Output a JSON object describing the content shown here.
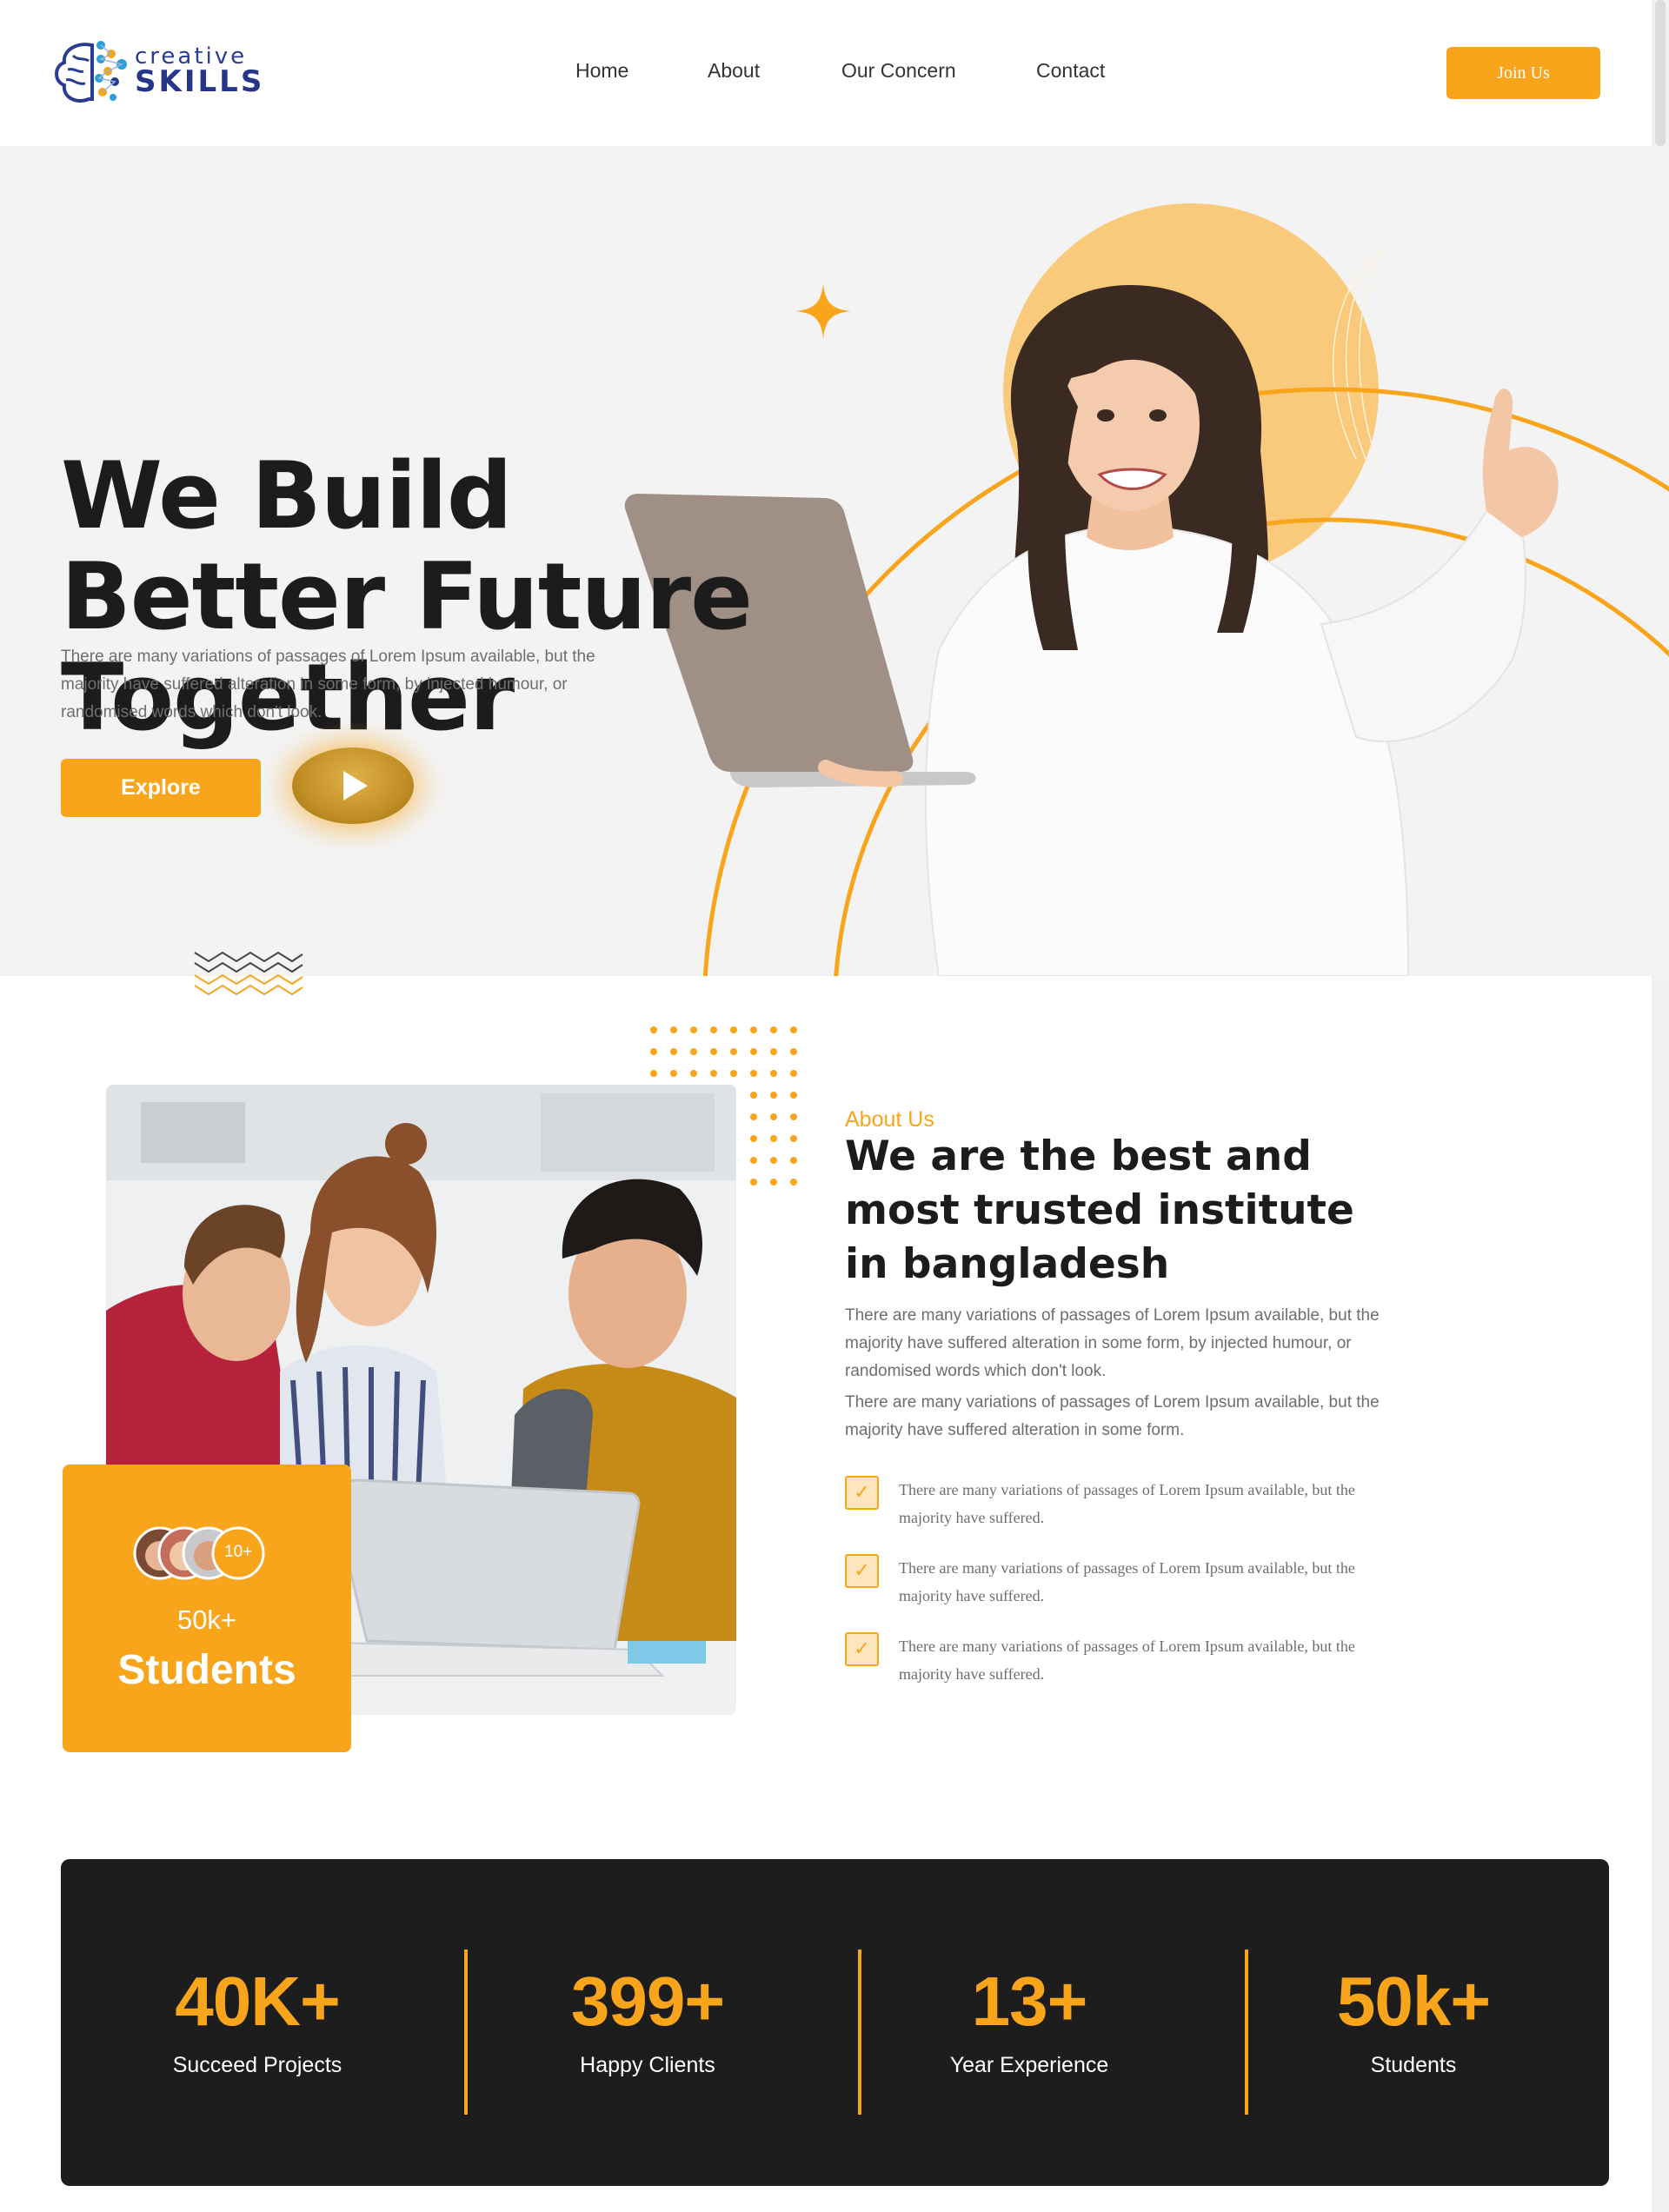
{
  "brand": {
    "line1": "creative",
    "line2": "SKILLS",
    "accent": "#f8a51c",
    "dark": "#1e1d1e",
    "navy": "#24358a"
  },
  "nav": {
    "items": [
      "Home",
      "About",
      "Our Concern",
      "Contact"
    ],
    "join_label": "Join Us"
  },
  "hero": {
    "title_line1": "We Build",
    "title_line2": "Better Future",
    "title_line3": "Together",
    "description": "There are many variations of passages of Lorem Ipsum available, but the majority have suffered alteration in some form, by injected humour, or randomised words which don't look.",
    "explore_label": "Explore",
    "play_icon": "play-icon"
  },
  "about": {
    "kicker": "About Us",
    "title": "We are the best and most trusted institute in bangladesh",
    "para1": "There are many variations of passages of Lorem Ipsum available, but the majority have suffered alteration in some form, by injected humour, or randomised words which don't look.",
    "para2": "There are many variations of passages of Lorem Ipsum available, but the majority have suffered alteration in some form.",
    "checks": [
      "There are many variations of passages of Lorem Ipsum available, but the majority have suffered.",
      "There are many variations of passages of Lorem Ipsum available, but the majority have suffered.",
      "There are many variations of passages of Lorem Ipsum available, but the majority have suffered."
    ],
    "students_card": {
      "avatar_count": "10+",
      "number": "50k+",
      "label": "Students"
    }
  },
  "stats": [
    {
      "value": "40K+",
      "label": "Succeed Projects"
    },
    {
      "value": "399+",
      "label": "Happy Clients"
    },
    {
      "value": "13+",
      "label": "Year Experience"
    },
    {
      "value": "50k+",
      "label": "Students"
    }
  ]
}
